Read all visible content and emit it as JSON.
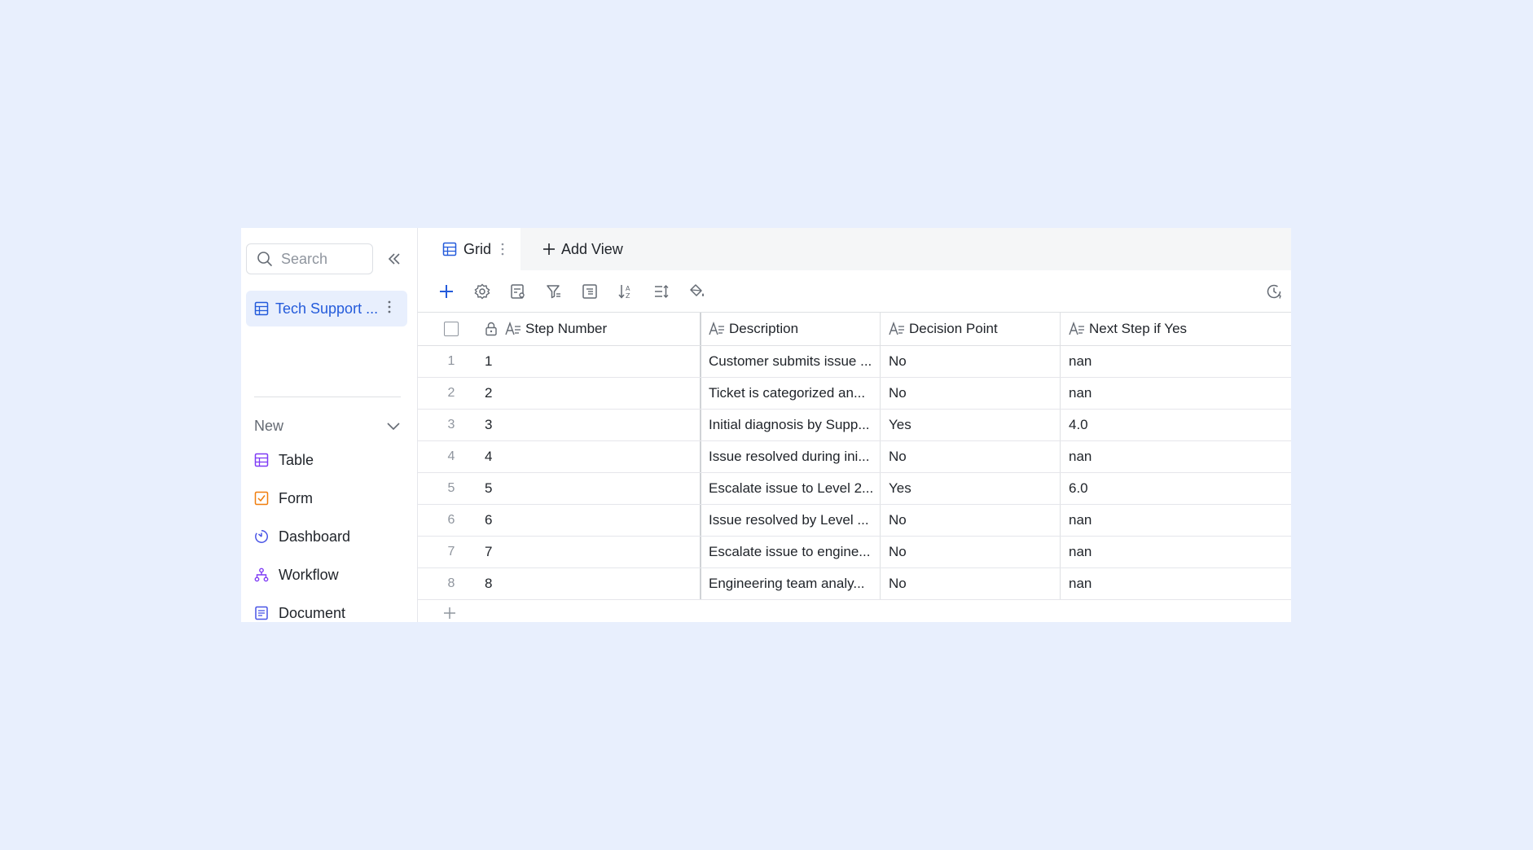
{
  "sidebar": {
    "search_placeholder": "Search",
    "table_name": "Tech Support ...",
    "new_label": "New",
    "new_items": [
      {
        "label": "Table",
        "icon": "table-icon"
      },
      {
        "label": "Form",
        "icon": "form-icon"
      },
      {
        "label": "Dashboard",
        "icon": "dashboard-icon"
      },
      {
        "label": "Workflow",
        "icon": "workflow-icon"
      },
      {
        "label": "Document",
        "icon": "document-icon"
      }
    ]
  },
  "tabs": {
    "grid_label": "Grid",
    "add_view_label": "Add View"
  },
  "grid": {
    "columns": [
      "Step Number",
      "Description",
      "Decision Point",
      "Next Step if Yes"
    ],
    "rows": [
      {
        "index": "1",
        "step": "1",
        "description": "Customer submits issue ...",
        "decision": "No",
        "next": "nan"
      },
      {
        "index": "2",
        "step": "2",
        "description": "Ticket is categorized an...",
        "decision": "No",
        "next": "nan"
      },
      {
        "index": "3",
        "step": "3",
        "description": "Initial diagnosis by Supp...",
        "decision": "Yes",
        "next": "4.0"
      },
      {
        "index": "4",
        "step": "4",
        "description": "Issue resolved during ini...",
        "decision": "No",
        "next": "nan"
      },
      {
        "index": "5",
        "step": "5",
        "description": "Escalate issue to Level 2...",
        "decision": "Yes",
        "next": "6.0"
      },
      {
        "index": "6",
        "step": "6",
        "description": "Issue resolved by Level ...",
        "decision": "No",
        "next": "nan"
      },
      {
        "index": "7",
        "step": "7",
        "description": "Escalate issue to engine...",
        "decision": "No",
        "next": "nan"
      },
      {
        "index": "8",
        "step": "8",
        "description": "Engineering team analy...",
        "decision": "No",
        "next": "nan"
      }
    ]
  },
  "colors": {
    "accent": "#245bdb",
    "background": "#e8effd",
    "form_icon": "#f07d0c",
    "table_icon": "#7f3bf5"
  }
}
